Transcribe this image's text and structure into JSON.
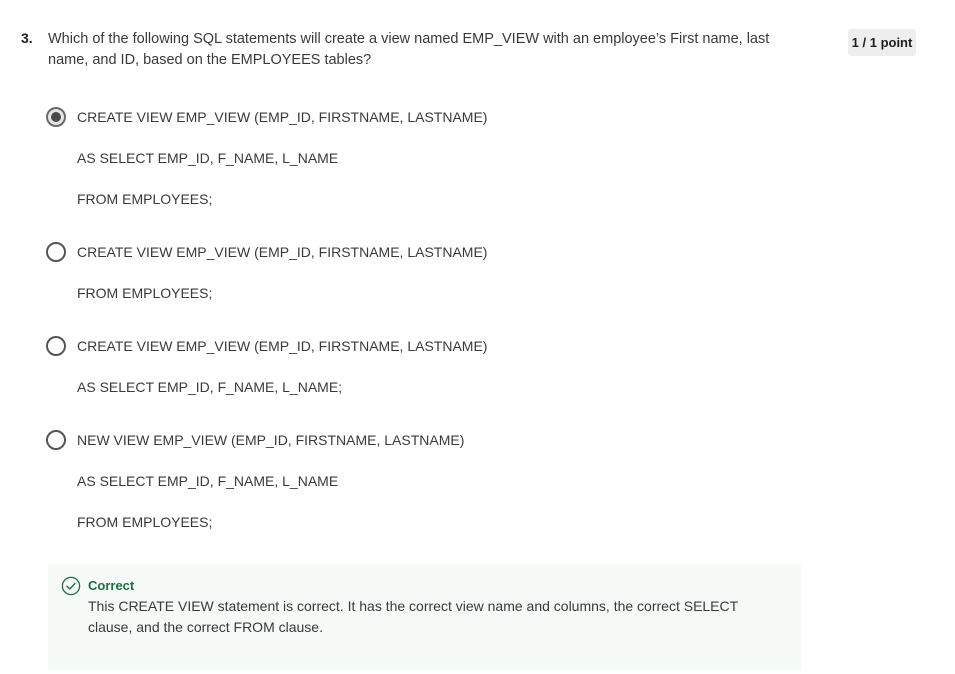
{
  "question": {
    "number": "3.",
    "text": "Which of the following SQL statements will create a view named EMP_VIEW with an employee’s First name, last name, and ID, based on the EMPLOYEES tables?",
    "points": "1 / 1 point"
  },
  "options": [
    {
      "selected": true,
      "lines": [
        "CREATE VIEW EMP_VIEW (EMP_ID, FIRSTNAME, LASTNAME)",
        "AS SELECT EMP_ID, F_NAME, L_NAME",
        "FROM EMPLOYEES;"
      ]
    },
    {
      "selected": false,
      "lines": [
        "CREATE VIEW EMP_VIEW (EMP_ID, FIRSTNAME, LASTNAME)",
        "FROM EMPLOYEES;"
      ]
    },
    {
      "selected": false,
      "lines": [
        "CREATE VIEW EMP_VIEW (EMP_ID, FIRSTNAME, LASTNAME)",
        "AS SELECT EMP_ID, F_NAME, L_NAME;"
      ]
    },
    {
      "selected": false,
      "lines": [
        "NEW VIEW EMP_VIEW (EMP_ID, FIRSTNAME, LASTNAME)",
        "AS SELECT EMP_ID, F_NAME, L_NAME",
        "FROM EMPLOYEES;"
      ]
    }
  ],
  "feedback": {
    "icon": "check-circle-icon",
    "title": "Correct",
    "body": "This CREATE VIEW statement is correct. It has the correct view name and columns, the correct SELECT clause, and the correct FROM clause.",
    "accent_color": "#1f6e43",
    "background_color": "#f5faf7"
  }
}
